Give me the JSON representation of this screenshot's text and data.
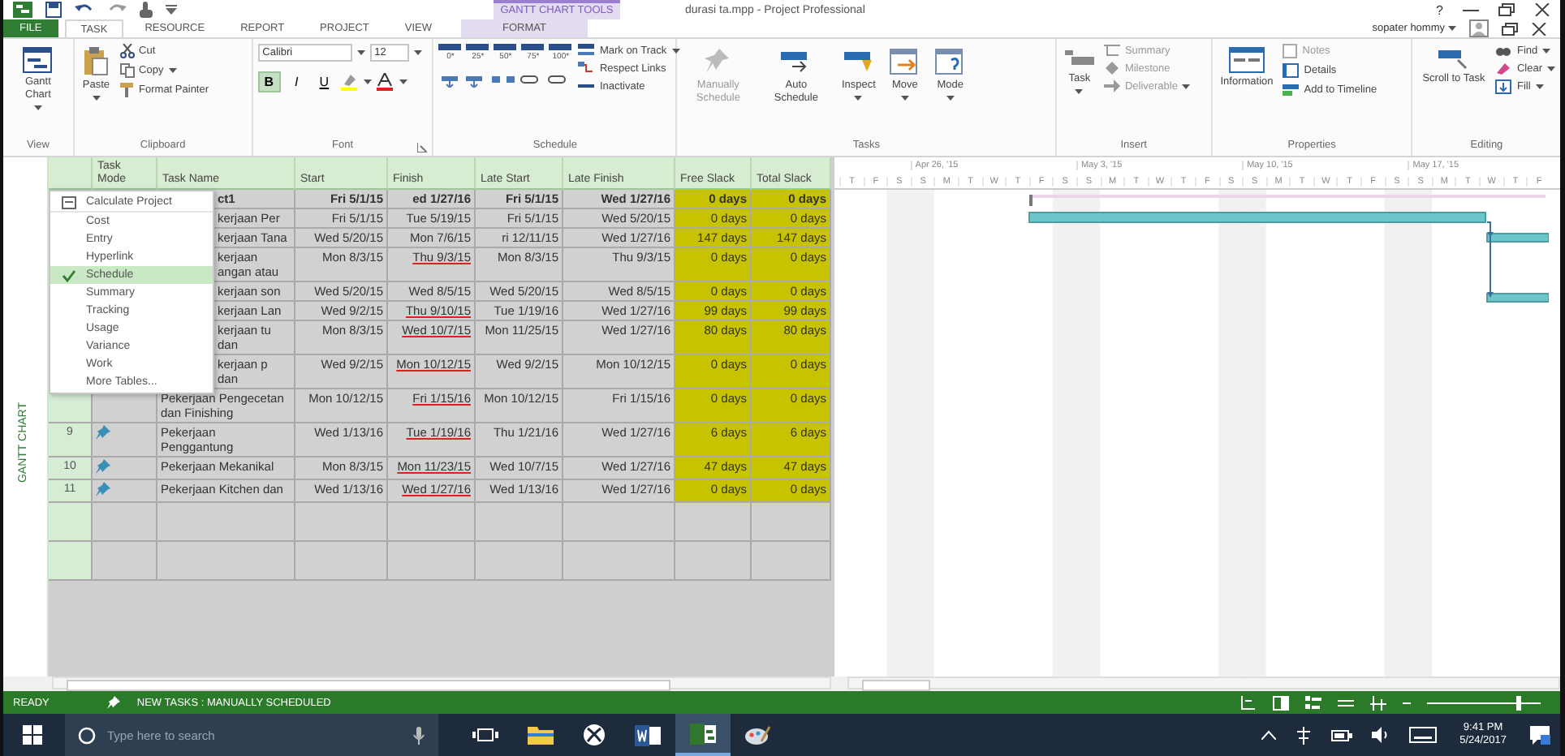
{
  "title_bar": {
    "context_label": "GANTT CHART TOOLS",
    "title": "durasi ta.mpp - Project Professional",
    "help": "?"
  },
  "tabs": [
    {
      "label": "FILE",
      "kind": "file",
      "selected": false
    },
    {
      "label": "TASK",
      "kind": "normal",
      "selected": true
    },
    {
      "label": "RESOURCE",
      "kind": "normal",
      "selected": false
    },
    {
      "label": "REPORT",
      "kind": "normal",
      "selected": false
    },
    {
      "label": "PROJECT",
      "kind": "normal",
      "selected": false
    },
    {
      "label": "VIEW",
      "kind": "normal",
      "selected": false
    },
    {
      "label": "FORMAT",
      "kind": "contextual",
      "selected": false
    }
  ],
  "user": "sopater hommy",
  "ribbon": {
    "view": {
      "button": "Gantt Chart",
      "label": "View"
    },
    "clipboard": {
      "paste": "Paste",
      "cut": "Cut",
      "copy": "Copy",
      "format_painter": "Format Painter",
      "label": "Clipboard"
    },
    "font": {
      "family": "Calibri",
      "size": "12",
      "bold": "B",
      "italic": "I",
      "underline": "U",
      "label": "Font"
    },
    "schedule": {
      "percents": [
        "0*",
        "25*",
        "50*",
        "75*",
        "100*"
      ],
      "mark_on_track": "Mark on Track",
      "respect_links": "Respect Links",
      "inactivate": "Inactivate",
      "label": "Schedule"
    },
    "tasks": {
      "manually": "Manually Schedule",
      "auto": "Auto Schedule",
      "inspect": "Inspect",
      "move": "Move",
      "mode": "Mode",
      "label": "Tasks"
    },
    "insert": {
      "task": "Task",
      "summary": "Summary",
      "milestone": "Milestone",
      "deliverable": "Deliverable",
      "label": "Insert"
    },
    "properties": {
      "information": "Information",
      "notes": "Notes",
      "details": "Details",
      "add_to_timeline": "Add to Timeline",
      "label": "Properties"
    },
    "editing": {
      "scroll": "Scroll to Task",
      "find": "Find",
      "clear": "Clear",
      "fill": "Fill",
      "label": "Editing"
    }
  },
  "side_label": "GANTT CHART",
  "table": {
    "columns": [
      "Task Mode",
      "Task Name",
      "Start",
      "Finish",
      "Late Start",
      "Late Finish",
      "Free Slack",
      "Total Slack"
    ],
    "rows": [
      {
        "kind": "summary",
        "covered": true,
        "name": "ct1",
        "start": "Fri 5/1/15",
        "finish": "ed 1/27/16",
        "finish_changed": false,
        "late_start": "Fri 5/1/15",
        "late_finish": "Wed 1/27/16",
        "free_slack": "0 days",
        "total_slack": "0 days"
      },
      {
        "kind": "task",
        "covered": true,
        "name": "kerjaan Per",
        "start": "Fri 5/1/15",
        "finish": "Tue 5/19/15",
        "finish_changed": false,
        "late_start": "Fri 5/1/15",
        "late_finish": "Wed 5/20/15",
        "free_slack": "0 days",
        "total_slack": "0 days"
      },
      {
        "kind": "task",
        "covered": true,
        "name": "kerjaan Tana",
        "start": "Wed 5/20/15",
        "finish": "Mon 7/6/15",
        "finish_changed": false,
        "late_start": "ri 12/11/15",
        "late_finish": "Wed 1/27/16",
        "free_slack": "147 days",
        "total_slack": "147 days"
      },
      {
        "kind": "task",
        "covered": true,
        "name": "kerjaan angan atau",
        "start": "Mon 8/3/15",
        "finish": "Thu 9/3/15",
        "finish_changed": true,
        "late_start": "Mon 8/3/15",
        "late_finish": "Thu 9/3/15",
        "free_slack": "0 days",
        "total_slack": "0 days"
      },
      {
        "kind": "task",
        "covered": true,
        "name": "kerjaan son",
        "start": "Wed 5/20/15",
        "finish": "Wed 8/5/15",
        "finish_changed": false,
        "late_start": "Wed 5/20/15",
        "late_finish": "Wed 8/5/15",
        "free_slack": "0 days",
        "total_slack": "0 days"
      },
      {
        "kind": "task",
        "covered": true,
        "name": "kerjaan Lan",
        "start": "Wed 9/2/15",
        "finish": "Thu 9/10/15",
        "finish_changed": true,
        "late_start": "Tue 1/19/16",
        "late_finish": "Wed 1/27/16",
        "free_slack": "99 days",
        "total_slack": "99 days"
      },
      {
        "kind": "task",
        "covered": true,
        "name": "kerjaan tu dan",
        "start": "Mon 8/3/15",
        "finish": "Wed 10/7/15",
        "finish_changed": true,
        "late_start": "Mon 11/25/15",
        "late_finish": "Wed 1/27/16",
        "free_slack": "80 days",
        "total_slack": "80 days"
      },
      {
        "kind": "task",
        "covered": true,
        "name": "kerjaan p dan",
        "start": "Wed 9/2/15",
        "finish": "Mon 10/12/15",
        "finish_changed": true,
        "late_start": "Wed 9/2/15",
        "late_finish": "Mon 10/12/15",
        "free_slack": "0 days",
        "total_slack": "0 days"
      },
      {
        "kind": "task",
        "covered": false,
        "pinned": false,
        "name": "Pekerjaan Pengecetan dan Finishing",
        "start": "Mon 10/12/15",
        "finish": "Fri 1/15/16",
        "finish_changed": true,
        "late_start": "Mon 10/12/15",
        "late_finish": "Fri 1/15/16",
        "free_slack": "0 days",
        "total_slack": "0 days"
      },
      {
        "kind": "task",
        "covered": false,
        "number": "9",
        "pinned": true,
        "name": "Pekerjaan Penggantung",
        "start": "Wed 1/13/16",
        "finish": "Tue 1/19/16",
        "finish_changed": true,
        "late_start": "Thu 1/21/16",
        "late_finish": "Wed 1/27/16",
        "free_slack": "6 days",
        "total_slack": "6 days"
      },
      {
        "kind": "task",
        "covered": false,
        "number": "10",
        "pinned": true,
        "name": "Pekerjaan Mekanikal",
        "start": "Mon 8/3/15",
        "finish": "Mon 11/23/15",
        "finish_changed": true,
        "late_start": "Wed 10/7/15",
        "late_finish": "Wed 1/27/16",
        "free_slack": "47 days",
        "total_slack": "47 days"
      },
      {
        "kind": "task",
        "covered": false,
        "number": "11",
        "pinned": true,
        "name": "Pekerjaan Kitchen dan",
        "start": "Wed 1/13/16",
        "finish": "Wed 1/27/16",
        "finish_changed": true,
        "late_start": "Wed 1/13/16",
        "late_finish": "Wed 1/27/16",
        "free_slack": "0 days",
        "total_slack": "0 days"
      }
    ]
  },
  "table_menu": [
    {
      "label": "Calculate Project",
      "kind": "command",
      "checked": false
    },
    {
      "label": "Cost",
      "kind": "table",
      "checked": false
    },
    {
      "label": "Entry",
      "kind": "table",
      "checked": false
    },
    {
      "label": "Hyperlink",
      "kind": "table",
      "checked": false
    },
    {
      "label": "Schedule",
      "kind": "table",
      "checked": true
    },
    {
      "label": "Summary",
      "kind": "table",
      "checked": false
    },
    {
      "label": "Tracking",
      "kind": "table",
      "checked": false
    },
    {
      "label": "Usage",
      "kind": "table",
      "checked": false
    },
    {
      "label": "Variance",
      "kind": "table",
      "checked": false
    },
    {
      "label": "Work",
      "kind": "table",
      "checked": false
    },
    {
      "label": "More Tables...",
      "kind": "table",
      "checked": false
    }
  ],
  "timescale": {
    "weeks": [
      "Apr 26, '15",
      "May 3, '15",
      "May 10, '15",
      "May 17, '15"
    ],
    "days": [
      "T",
      "F",
      "S",
      "S",
      "M",
      "T",
      "W",
      "T",
      "F",
      "S",
      "S",
      "M",
      "T",
      "W",
      "T",
      "F",
      "S",
      "S",
      "M",
      "T",
      "W",
      "T",
      "F",
      "S",
      "S",
      "M",
      "T",
      "W",
      "T",
      "F"
    ]
  },
  "status_bar": {
    "ready": "READY",
    "new_tasks": "NEW TASKS : MANUALLY SCHEDULED",
    "zoom": {
      "level": 0.78
    }
  },
  "taskbar": {
    "search_placeholder": "Type here to search",
    "time": "9:41 PM",
    "date": "5/24/2017"
  }
}
